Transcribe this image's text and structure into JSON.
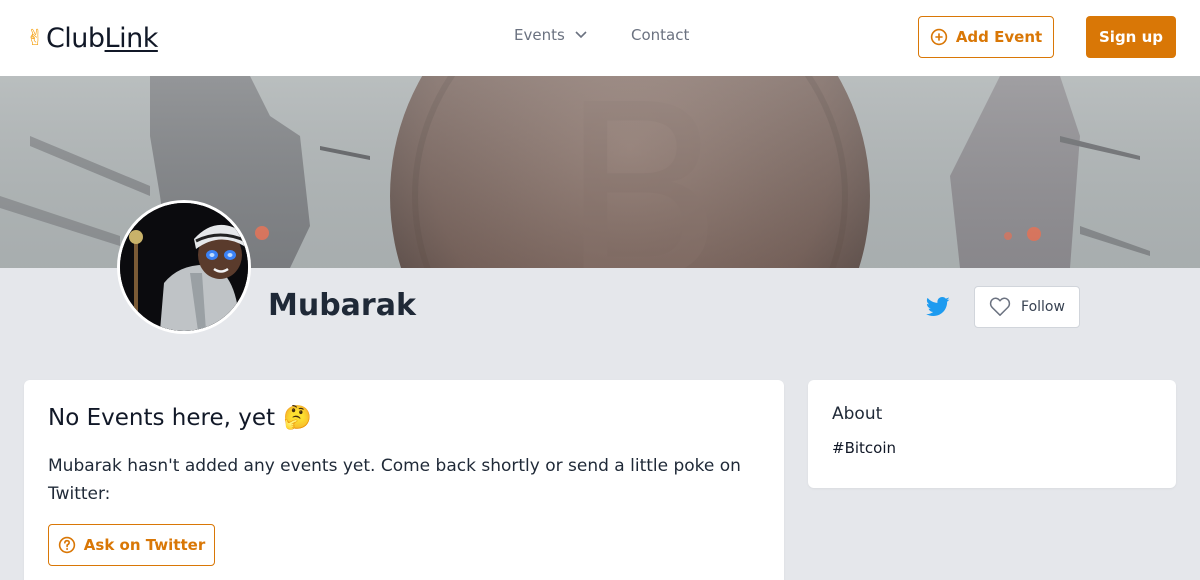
{
  "brand": {
    "name_a": "Club",
    "name_b": "Link",
    "hand_glyph": "✌"
  },
  "nav": {
    "events_label": "Events",
    "contact_label": "Contact",
    "add_event_label": "Add Event",
    "signup_label": "Sign up"
  },
  "profile": {
    "name": "Mubarak",
    "follow_label": "Follow"
  },
  "main": {
    "title": "No Events here, yet",
    "title_emoji": "🤔",
    "message": "Mubarak hasn't added any events yet. Come back shortly or send a little poke on Twitter:",
    "ask_label": "Ask on Twitter"
  },
  "about": {
    "title": "About",
    "tag": "#Bitcoin"
  },
  "colors": {
    "accent": "#d97706",
    "twitter": "#1d9bf0",
    "page_bg": "#e5e7eb"
  }
}
